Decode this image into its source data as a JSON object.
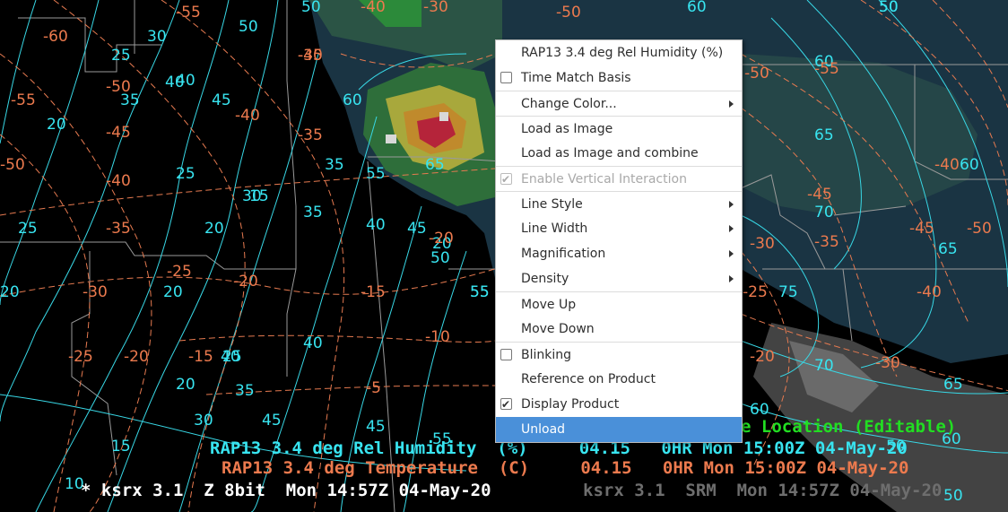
{
  "context_menu": {
    "items": [
      {
        "label": "RAP13 3.4 deg Rel Humidity  (%)",
        "type": "plain"
      },
      {
        "label": "Time Match Basis",
        "type": "checkbox",
        "checked": false
      },
      {
        "label": "Change Color...",
        "type": "submenu"
      },
      {
        "label": "Load as Image",
        "type": "plain"
      },
      {
        "label": "Load as Image and combine",
        "type": "plain"
      },
      {
        "label": "Enable Vertical Interaction",
        "type": "checkbox",
        "checked": true,
        "disabled": true
      },
      {
        "label": "Line Style",
        "type": "submenu"
      },
      {
        "label": "Line Width",
        "type": "submenu"
      },
      {
        "label": "Magnification",
        "type": "submenu"
      },
      {
        "label": "Density",
        "type": "submenu"
      },
      {
        "label": "Move Up",
        "type": "plain"
      },
      {
        "label": "Move Down",
        "type": "plain"
      },
      {
        "label": "Blinking",
        "type": "checkbox",
        "checked": false
      },
      {
        "label": "Reference on Product",
        "type": "plain"
      },
      {
        "label": "Display Product",
        "type": "checkbox",
        "checked": true
      },
      {
        "label": "Unload",
        "type": "plain",
        "selected": true
      }
    ]
  },
  "legend": {
    "location_text": "e Location (Editable)",
    "rh_line": "RAP13 3.4 deg Rel Humidity  (%)     04.15   0HR Mon 15:00Z 04-May-20",
    "temp_line": "RAP13 3.4 deg Temperature  (C)     04.15   0HR Mon 15:00Z 04-May-20",
    "radar_line": "* ksrx 3.1  Z 8bit  Mon 14:57Z 04-May-20",
    "radar_dim_line": "ksrx 3.1  SRM  Mon 14:57Z 04-May-20"
  },
  "colors": {
    "rh_contour": "#38e4f0",
    "temp_contour": "#ec7a4e",
    "location_legend": "#22dd22",
    "menu_highlight": "#4a90d9"
  },
  "contour_labels": {
    "rh": [
      "50",
      "30",
      "25",
      "40",
      "35",
      "45",
      "20",
      "25",
      "25",
      "20",
      "50",
      "35",
      "40",
      "45",
      "30",
      "35",
      "60",
      "55",
      "40",
      "20",
      "45",
      "15",
      "40",
      "20",
      "50",
      "55",
      "25",
      "35",
      "40",
      "30",
      "45",
      "20",
      "15",
      "10",
      "60",
      "65",
      "60",
      "75",
      "65",
      "70",
      "65",
      "60",
      "55",
      "55",
      "60",
      "50",
      "65",
      "20",
      "70",
      "50",
      "60",
      "50",
      "50"
    ],
    "temp": [
      "-55",
      "-60",
      "-50",
      "-55",
      "-40",
      "-45",
      "-40",
      "-35",
      "-50",
      "-35",
      "-25",
      "-30",
      "-20",
      "-15",
      "-20",
      "-15",
      "-25",
      "-10",
      "-5",
      "-30",
      "-40",
      "-45",
      "-55",
      "-50",
      "-30",
      "-50",
      "-45",
      "-35",
      "-40",
      "-45",
      "-25",
      "-30",
      "-20",
      "-30",
      "-20",
      "-40",
      "-50"
    ]
  }
}
